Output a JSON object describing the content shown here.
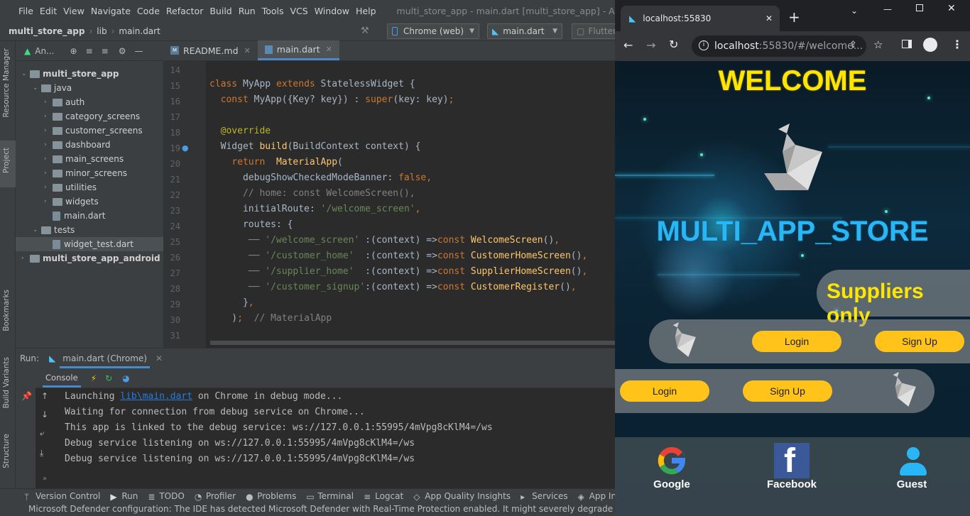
{
  "ide": {
    "menu": [
      "File",
      "Edit",
      "View",
      "Navigate",
      "Code",
      "Refactor",
      "Build",
      "Run",
      "Tools",
      "VCS",
      "Window",
      "Help"
    ],
    "window_title": "multi_store_app - main.dart [multi_store_app] - Administ",
    "breadcrumb": {
      "project": "multi_store_app",
      "folder": "lib",
      "file": "main.dart"
    },
    "device_combo": "Chrome (web)",
    "run_config": "main.dart",
    "flutter_label": "Flutter",
    "project_view_label": "An...",
    "side_labels": {
      "resource_manager": "Resource Manager",
      "project": "Project",
      "bookmarks": "Bookmarks",
      "build_variants": "Build Variants",
      "structure": "Structure"
    },
    "tree": [
      {
        "label": "multi_store_app",
        "depth": 0,
        "kind": "root",
        "expanded": true
      },
      {
        "label": "java",
        "depth": 1,
        "kind": "folder",
        "expanded": true
      },
      {
        "label": "auth",
        "depth": 2,
        "kind": "folder"
      },
      {
        "label": "category_screens",
        "depth": 2,
        "kind": "folder"
      },
      {
        "label": "customer_screens",
        "depth": 2,
        "kind": "folder"
      },
      {
        "label": "dashboard",
        "depth": 2,
        "kind": "folder"
      },
      {
        "label": "main_screens",
        "depth": 2,
        "kind": "folder"
      },
      {
        "label": "minor_screens",
        "depth": 2,
        "kind": "folder"
      },
      {
        "label": "utilities",
        "depth": 2,
        "kind": "folder"
      },
      {
        "label": "widgets",
        "depth": 2,
        "kind": "folder"
      },
      {
        "label": "main.dart",
        "depth": 2,
        "kind": "file"
      },
      {
        "label": "tests",
        "depth": 1,
        "kind": "folder",
        "expanded": true
      },
      {
        "label": "widget_test.dart",
        "depth": 2,
        "kind": "file",
        "selected": true
      },
      {
        "label": "multi_store_app_android",
        "depth": 0,
        "kind": "root"
      }
    ],
    "tabs": [
      {
        "label": "README.md",
        "active": false
      },
      {
        "label": "main.dart",
        "active": true
      }
    ],
    "line_numbers": [
      "14",
      "15",
      "16",
      "17",
      "18",
      "19",
      "20",
      "21",
      "22",
      "23",
      "24",
      "25",
      "26",
      "27",
      "28",
      "29",
      "30",
      "31"
    ],
    "run": {
      "label": "Run:",
      "config_tab": "main.dart (Chrome)",
      "console_tab": "Console",
      "lines": [
        {
          "pre": "Launching ",
          "link": "lib\\main.dart",
          "post": " on Chrome in debug mode..."
        },
        {
          "pre": "Waiting for connection from debug service on Chrome...",
          "link": "",
          "post": ""
        },
        {
          "pre": "This app is linked to the debug service: ws://127.0.0.1:55995/4mVpg8cKlM4=/ws",
          "link": "",
          "post": ""
        },
        {
          "pre": "Debug service listening on ws://127.0.0.1:55995/4mVpg8cKlM4=/ws",
          "link": "",
          "post": ""
        },
        {
          "pre": "Debug service listening on ws://127.0.0.1:55995/4mVpg8cKlM4=/ws",
          "link": "",
          "post": ""
        }
      ]
    },
    "bottom_tools": [
      "Version Control",
      "Run",
      "TODO",
      "Profiler",
      "Problems",
      "Terminal",
      "Logcat",
      "App Quality Insights",
      "Services",
      "App In"
    ],
    "status_message": "Microsoft Defender configuration: The IDE has detected Microsoft Defender with Real-Time Protection enabled. It might severely degrade IDE performance. It"
  },
  "browser": {
    "tab_title": "localhost:55830",
    "url_host": "localhost",
    "url_rest": ":55830/#/welcome...",
    "app": {
      "welcome": "WELCOME",
      "store_name": "MULTI_APP_STORE",
      "suppliers_only": "Suppliers only",
      "login": "Login",
      "signup": "Sign Up",
      "social": [
        "Google",
        "Facebook",
        "Guest"
      ]
    },
    "colors": {
      "accent": "#ffc31a",
      "title_yellow": "#ffe600",
      "store_blue": "#29b6f6"
    }
  }
}
